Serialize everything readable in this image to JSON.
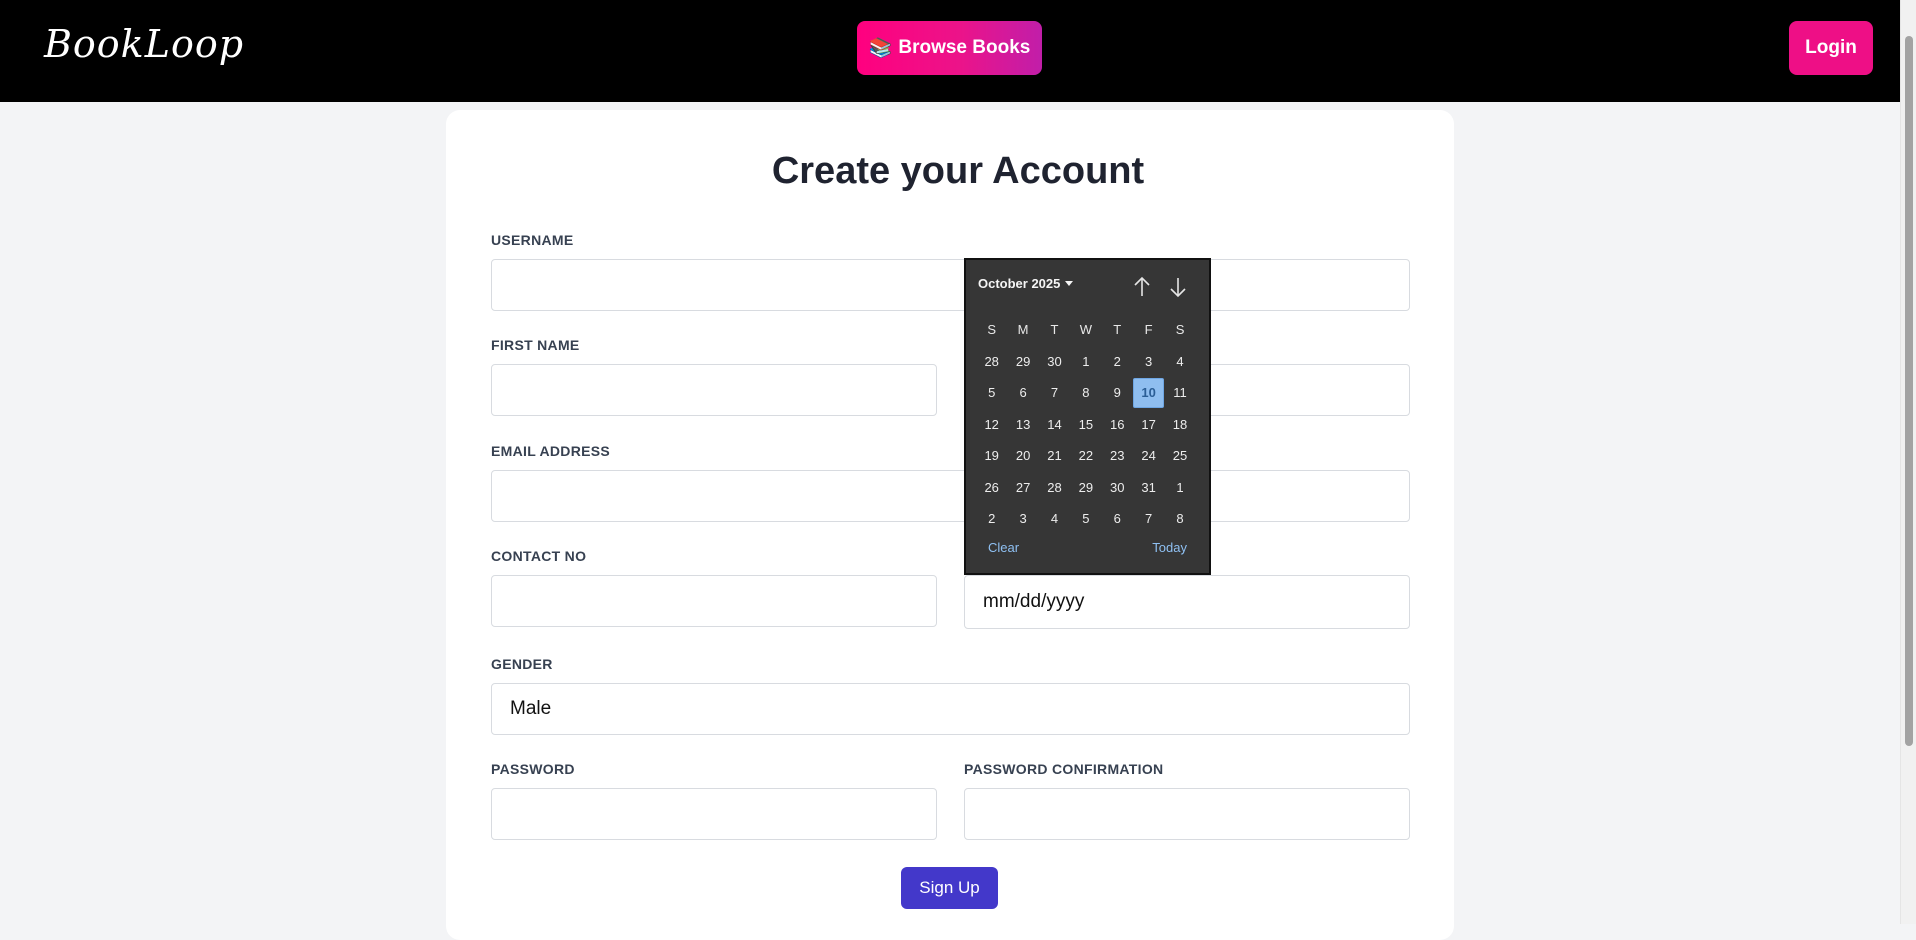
{
  "navbar": {
    "logo_text": "BookLoop",
    "browse_label": "Browse Books",
    "browse_emoji": "📚",
    "login_label": "Login"
  },
  "form": {
    "title": "Create your Account",
    "username_label": "USERNAME",
    "first_name_label": "FIRST NAME",
    "email_label": "EMAIL ADDRESS",
    "contact_label": "CONTACT NO",
    "dob_placeholder": "mm/dd/yyyy",
    "gender_label": "GENDER",
    "gender_value": "Male",
    "password_label": "PASSWORD",
    "password_confirm_label": "PASSWORD CONFIRMATION",
    "submit_label": "Sign Up"
  },
  "datepicker": {
    "month_label": "October 2025",
    "weekdays": [
      "S",
      "M",
      "T",
      "W",
      "T",
      "F",
      "S"
    ],
    "weeks": [
      [
        "28",
        "29",
        "30",
        "1",
        "2",
        "3",
        "4"
      ],
      [
        "5",
        "6",
        "7",
        "8",
        "9",
        "10",
        "11"
      ],
      [
        "12",
        "13",
        "14",
        "15",
        "16",
        "17",
        "18"
      ],
      [
        "19",
        "20",
        "21",
        "22",
        "23",
        "24",
        "25"
      ],
      [
        "26",
        "27",
        "28",
        "29",
        "30",
        "31",
        "1"
      ],
      [
        "2",
        "3",
        "4",
        "5",
        "6",
        "7",
        "8"
      ]
    ],
    "selected_day": "10",
    "clear_label": "Clear",
    "today_label": "Today"
  },
  "colors": {
    "navbar_bg": "#000000",
    "browse_gradient_start": "#ff007f",
    "browse_gradient_end": "#c11ea9",
    "login_bg": "#ee0f86",
    "signup_bg": "#4338ca",
    "datepicker_bg": "#363636",
    "selected_day_bg": "#8fbef0"
  }
}
